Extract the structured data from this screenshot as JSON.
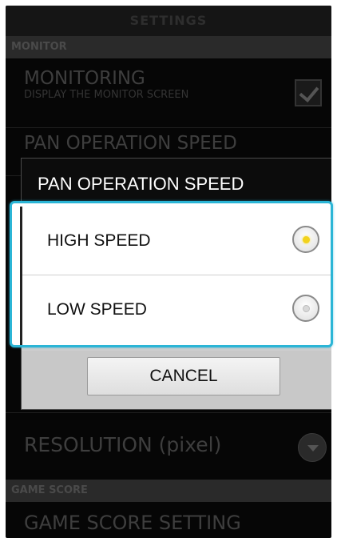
{
  "screen": {
    "title": "SETTINGS",
    "sections": {
      "monitor": "MONITOR",
      "game_score": "GAME SCORE"
    },
    "monitoring": {
      "title": "MONITORING",
      "subtitle": "DISPLAY THE MONITOR SCREEN",
      "checked": true
    },
    "pan_operation_speed_row": {
      "title": "PAN OPERATION SPEED"
    },
    "resolution": {
      "title": "RESOLUTION (pixel)",
      "icon": "chevron-down-icon"
    },
    "game_score_setting": {
      "title": "GAME SCORE SETTING"
    }
  },
  "dialog": {
    "title": "PAN OPERATION SPEED",
    "options": [
      {
        "label": "HIGH SPEED",
        "selected": true
      },
      {
        "label": "LOW SPEED",
        "selected": false
      }
    ],
    "cancel_label": "CANCEL",
    "highlight_color": "#2bb5d6",
    "selected_color": "#f2d21b"
  }
}
